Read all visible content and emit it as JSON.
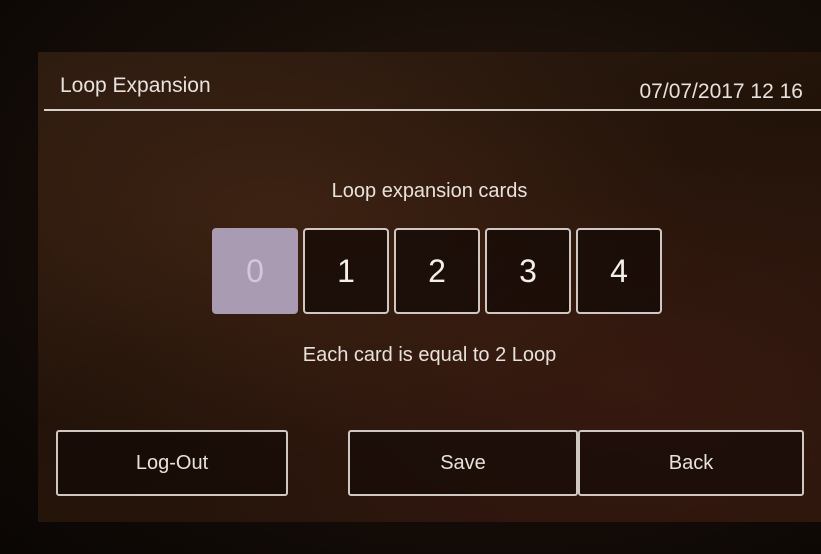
{
  "header": {
    "title": "Loop Expansion",
    "datetime": "07/07/2017 12 16"
  },
  "main": {
    "subtitle": "Loop expansion cards",
    "cards": [
      {
        "label": "0",
        "selected": true
      },
      {
        "label": "1",
        "selected": false
      },
      {
        "label": "2",
        "selected": false
      },
      {
        "label": "3",
        "selected": false
      },
      {
        "label": "4",
        "selected": false
      }
    ],
    "note": "Each card is equal to 2 Loop"
  },
  "footer": {
    "logout_label": "Log-Out",
    "save_label": "Save",
    "back_label": "Back"
  },
  "colors": {
    "selected_card": "#a99bb1",
    "text": "#e8e2dc",
    "border": "#cfc8c2"
  }
}
